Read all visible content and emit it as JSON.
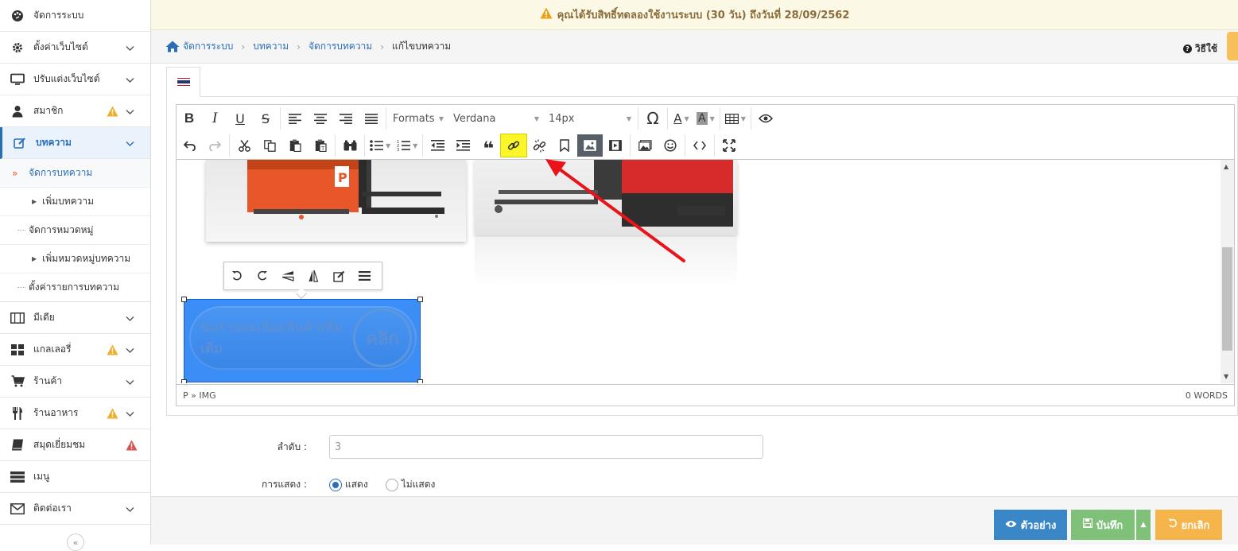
{
  "banner": {
    "text": "คุณได้รับสิทธิ์ทดลองใช้งานระบบ (30 วัน) ถึงวันที่ 28/09/2562"
  },
  "sidebar": {
    "items": [
      {
        "label": "จัดการระบบ",
        "icon": "palette-icon"
      },
      {
        "label": "ตั้งค่าเว็บไซต์",
        "icon": "gear-icon"
      },
      {
        "label": "ปรับแต่งเว็บไซต์",
        "icon": "monitor-icon"
      },
      {
        "label": "สมาชิก",
        "icon": "user-icon"
      },
      {
        "label": "บทความ",
        "icon": "edit-icon"
      },
      {
        "label": "มีเดีย",
        "icon": "film-icon"
      },
      {
        "label": "แกลเลอรี่",
        "icon": "grid-icon"
      },
      {
        "label": "ร้านค้า",
        "icon": "cart-icon"
      },
      {
        "label": "ร้านอาหาร",
        "icon": "utensils-icon"
      },
      {
        "label": "สมุดเยี่ยมชม",
        "icon": "book-icon"
      },
      {
        "label": "เมนู",
        "icon": "menu-icon"
      },
      {
        "label": "ติดต่อเรา",
        "icon": "envelope-icon"
      }
    ],
    "sub": [
      "จัดการบทความ",
      "เพิ่มบทความ",
      "จัดการหมวดหมู่",
      "เพิ่มหมวดหมู่บทความ",
      "ตั้งค่ารายการบทความ"
    ]
  },
  "breadcrumb": [
    "จัดการระบบ",
    "บทความ",
    "จัดการบทความ",
    "แก้ไขบทความ"
  ],
  "help": "วิธีใช้",
  "toolbar": {
    "formats": "Formats",
    "font": "Verdana",
    "size": "14px"
  },
  "editor": {
    "image_text_1": "ชมรายละเอียดสินค้าเพิ่มเติม",
    "image_text_2": "คลิก",
    "path": "P » IMG",
    "wordcount": "0 WORDS"
  },
  "form": {
    "order_label": "ลำดับ :",
    "order_value": "3",
    "display_label": "การแสดง :",
    "show": "แสดง",
    "hide": "ไม่แสดง"
  },
  "footer": {
    "preview": "ตัวอย่าง",
    "save": "บันทึก",
    "cancel": "ยกเลิก"
  },
  "colors": {
    "accent": "#2a6eb8",
    "highlight": "#fbf62a",
    "arrow": "#e8141a",
    "warn": "#f0ad2a"
  }
}
